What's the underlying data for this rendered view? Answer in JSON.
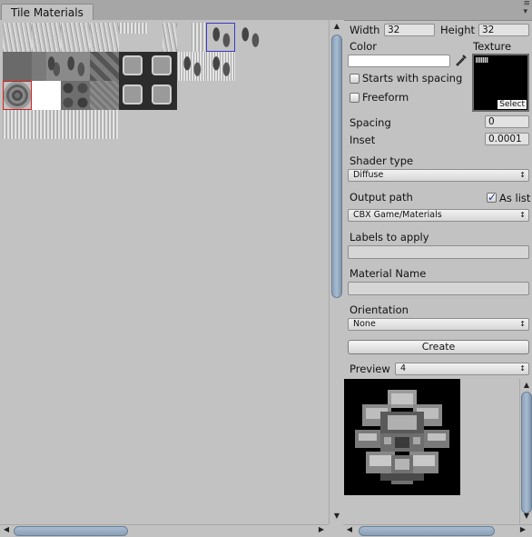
{
  "window": {
    "tab_title": "Tile Materials",
    "menu_icon": "window-menu-icon"
  },
  "inspector": {
    "width_label": "Width",
    "width_value": "32",
    "height_label": "Height",
    "height_value": "32",
    "color_label": "Color",
    "color_value": "#ffffff",
    "texture_label": "Texture",
    "texture_select": "Select",
    "starts_with_spacing_label": "Starts with spacing",
    "starts_with_spacing_checked": false,
    "freeform_label": "Freeform",
    "freeform_checked": false,
    "spacing_label": "Spacing",
    "spacing_value": "0",
    "inset_label": "Inset",
    "inset_value": "0.0001",
    "shader_type_label": "Shader type",
    "shader_type_value": "Diffuse",
    "output_path_label": "Output path",
    "as_list_label": "As list",
    "as_list_checked": true,
    "output_path_value": "CBX Game/Materials",
    "labels_to_apply_label": "Labels to apply",
    "labels_to_apply_value": "",
    "material_name_label": "Material Name",
    "material_name_value": "",
    "orientation_label": "Orientation",
    "orientation_value": "None",
    "create_button": "Create",
    "preview_label": "Preview",
    "preview_value": "4"
  },
  "icons": {
    "dropdown_caret": "↕",
    "eyedropper": "eyedropper-icon",
    "arrow_up": "▲",
    "arrow_down": "▼",
    "arrow_left": "◀",
    "arrow_right": "▶"
  },
  "colors": {
    "panel_bg": "#c2c2c2",
    "scroll_thumb": "#8aa0b8",
    "selection_blue": "#3a3ac8",
    "selection_red": "#d02020"
  }
}
